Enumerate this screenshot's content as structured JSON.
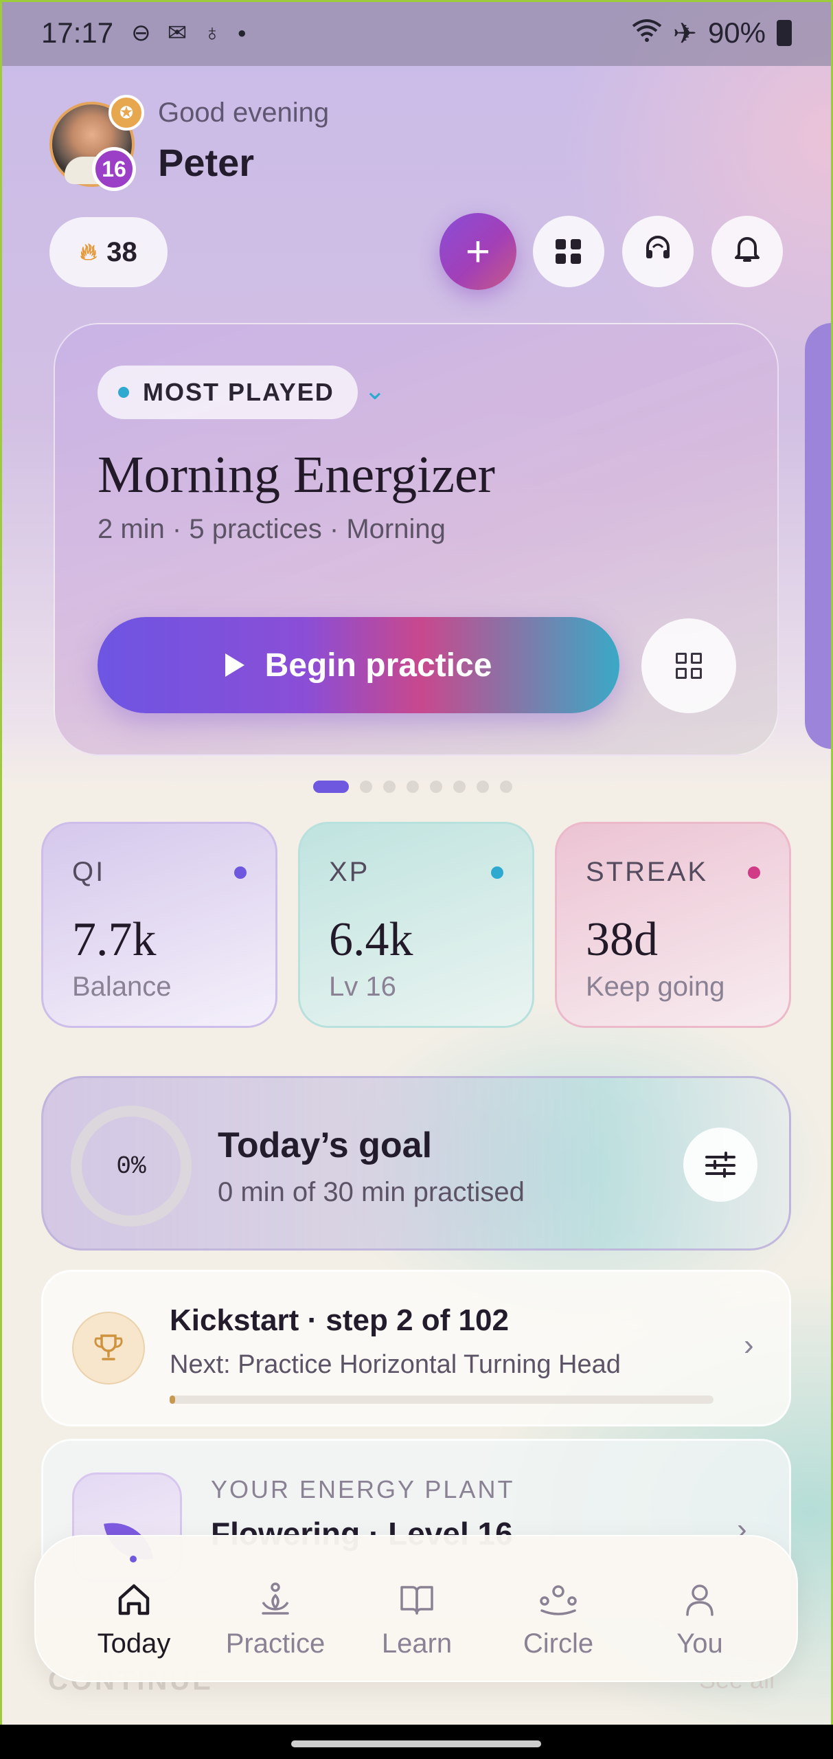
{
  "status_bar": {
    "time": "17:17",
    "left_icons": [
      "dnd-icon",
      "mail-icon",
      "bulb-icon",
      "dot-icon"
    ],
    "battery": "90%"
  },
  "header": {
    "greeting": "Good evening",
    "username": "Peter",
    "level_badge": "16"
  },
  "chips": {
    "streak_count": "38"
  },
  "hero": {
    "pill_label": "MOST PLAYED",
    "title": "Morning Energizer",
    "subtitle": "2 min · 5 practices · Morning",
    "cta_label": "Begin practice",
    "pager_count": 8,
    "pager_active": 0
  },
  "stats": [
    {
      "label": "QI",
      "value": "7.7k",
      "sub": "Balance",
      "dot_color": "#6e58e0"
    },
    {
      "label": "XP",
      "value": "6.4k",
      "sub": "Lv 16",
      "dot_color": "#2eaad0"
    },
    {
      "label": "STREAK",
      "value": "38d",
      "sub": "Keep going",
      "dot_color": "#d03a86"
    }
  ],
  "goal": {
    "percent_label": "0%",
    "title": "Today’s goal",
    "subtitle": "0 min of 30 min practised"
  },
  "kickstart": {
    "title": "Kickstart · step 2 of 102",
    "subtitle": "Next: Practice Horizontal Turning Head",
    "progress": 0.01
  },
  "plant": {
    "label": "YOUR ENERGY PLANT",
    "title": "Flowering · Level 16"
  },
  "continue_section": {
    "label": "CONTINUE",
    "see_all": "See all"
  },
  "nav": {
    "items": [
      {
        "label": "Today",
        "icon": "home-icon",
        "active": true
      },
      {
        "label": "Practice",
        "icon": "lotus-icon",
        "active": false
      },
      {
        "label": "Learn",
        "icon": "book-icon",
        "active": false
      },
      {
        "label": "Circle",
        "icon": "people-icon",
        "active": false
      },
      {
        "label": "You",
        "icon": "person-icon",
        "active": false
      }
    ]
  },
  "colors": {
    "accent": "#6e58e0",
    "pink": "#d03a86",
    "teal": "#2eaad0",
    "gold": "#cf9340"
  }
}
